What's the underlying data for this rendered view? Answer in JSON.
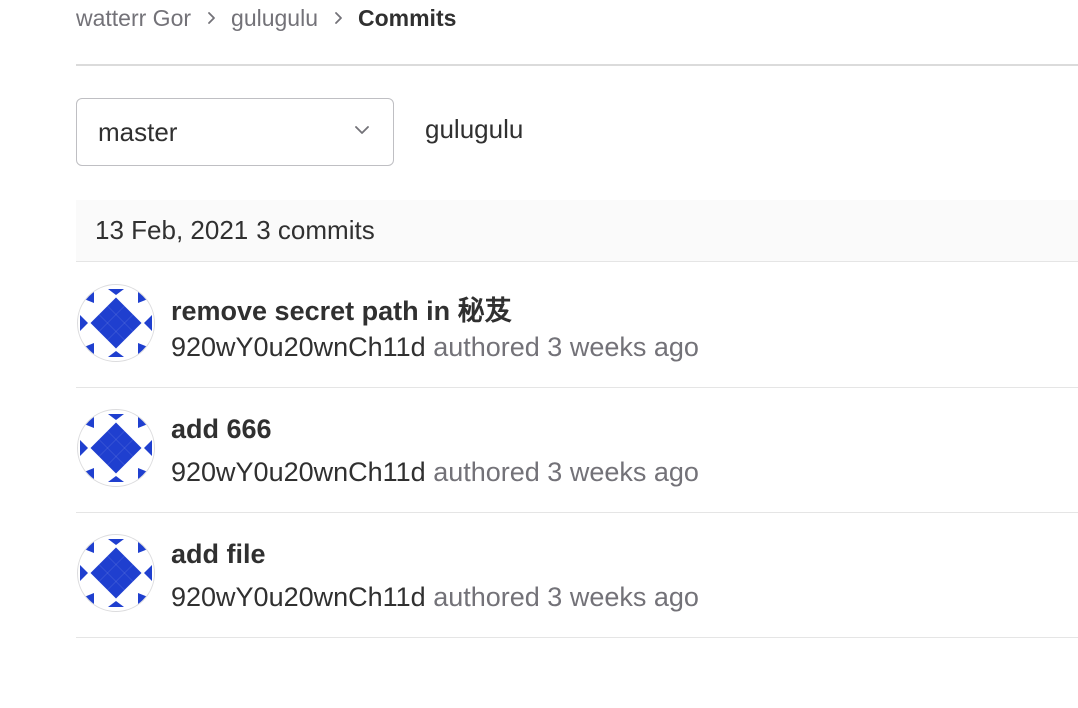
{
  "breadcrumb": {
    "items": [
      "watterr Gor",
      "gulugulu"
    ],
    "current": "Commits"
  },
  "branch_select": {
    "value": "master"
  },
  "path": "gulugulu",
  "day_group": {
    "date": "13 Feb, 2021",
    "count": "3 commits"
  },
  "commits": [
    {
      "title": "remove secret path in 秘芨",
      "author": "920wY0u20wnCh11d",
      "authored": "authored 3 weeks ago"
    },
    {
      "title": "add 666",
      "author": "920wY0u20wnCh11d",
      "authored": "authored 3 weeks ago"
    },
    {
      "title": "add file",
      "author": "920wY0u20wnCh11d",
      "authored": "authored 3 weeks ago"
    }
  ],
  "colors": {
    "avatar_pattern": "#1f3fcf",
    "text_primary": "#303030",
    "text_secondary": "#737278"
  },
  "icons": {
    "breadcrumb_separator": "chevron-right-icon",
    "dropdown": "chevron-down-icon",
    "avatar": "identicon-avatar"
  }
}
